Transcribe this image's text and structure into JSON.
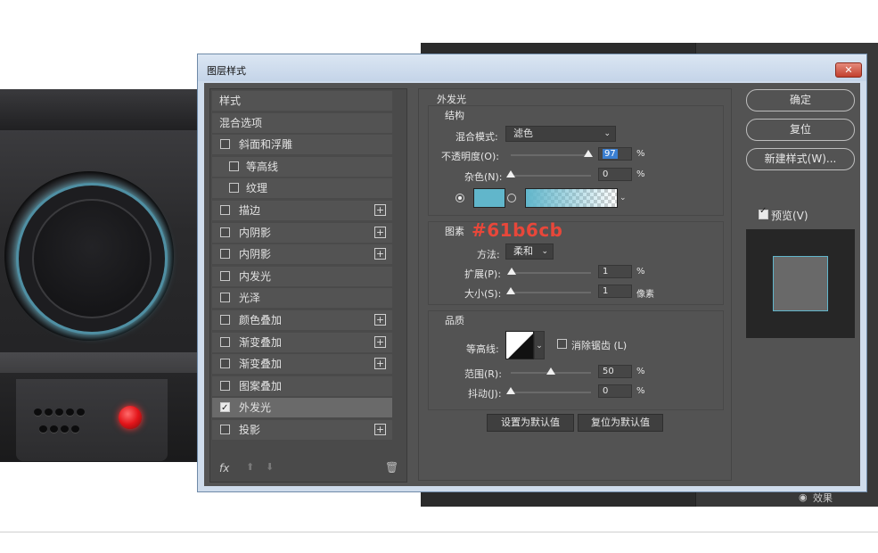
{
  "dialog": {
    "title": "图层样式",
    "close_label": "✕"
  },
  "styles": {
    "items": [
      {
        "label": "样式",
        "checkbox": false,
        "checked": false,
        "indent": false,
        "plus": false
      },
      {
        "label": "混合选项",
        "checkbox": false,
        "checked": false,
        "indent": false,
        "plus": false
      },
      {
        "label": "斜面和浮雕",
        "checkbox": true,
        "checked": false,
        "indent": false,
        "plus": false
      },
      {
        "label": "等高线",
        "checkbox": true,
        "checked": false,
        "indent": true,
        "plus": false
      },
      {
        "label": "纹理",
        "checkbox": true,
        "checked": false,
        "indent": true,
        "plus": false
      },
      {
        "label": "描边",
        "checkbox": true,
        "checked": false,
        "indent": false,
        "plus": true
      },
      {
        "label": "内阴影",
        "checkbox": true,
        "checked": false,
        "indent": false,
        "plus": true
      },
      {
        "label": "内阴影",
        "checkbox": true,
        "checked": false,
        "indent": false,
        "plus": true
      },
      {
        "label": "内发光",
        "checkbox": true,
        "checked": false,
        "indent": false,
        "plus": false
      },
      {
        "label": "光泽",
        "checkbox": true,
        "checked": false,
        "indent": false,
        "plus": false
      },
      {
        "label": "颜色叠加",
        "checkbox": true,
        "checked": false,
        "indent": false,
        "plus": true
      },
      {
        "label": "渐变叠加",
        "checkbox": true,
        "checked": false,
        "indent": false,
        "plus": true
      },
      {
        "label": "渐变叠加",
        "checkbox": true,
        "checked": false,
        "indent": false,
        "plus": true
      },
      {
        "label": "图案叠加",
        "checkbox": true,
        "checked": false,
        "indent": false,
        "plus": false
      },
      {
        "label": "外发光",
        "checkbox": true,
        "checked": true,
        "indent": false,
        "plus": false,
        "selected": true
      },
      {
        "label": "投影",
        "checkbox": true,
        "checked": false,
        "indent": false,
        "plus": true
      }
    ],
    "footer": {
      "fx": "fx",
      "up": "⬆",
      "down": "⬇",
      "trash": "🗑"
    }
  },
  "outer_glow": {
    "title": "外发光",
    "structure": {
      "title": "结构",
      "blend_mode_label": "混合模式:",
      "blend_mode_value": "滤色",
      "opacity_label": "不透明度(O):",
      "opacity_value": "97",
      "opacity_level": 0.97,
      "noise_label": "杂色(N):",
      "noise_value": "0",
      "noise_level": 0.0,
      "percent": "%",
      "color": "#61b6cb"
    },
    "annotation": "#61b6cb",
    "elements": {
      "title": "图素",
      "method_label": "方法:",
      "method_value": "柔和",
      "spread_label": "扩展(P):",
      "spread_value": "1",
      "spread_level": 0.01,
      "size_label": "大小(S):",
      "size_value": "1",
      "size_level": 0.004,
      "pixels_unit": "像素",
      "percent": "%"
    },
    "quality": {
      "title": "品质",
      "contour_label": "等高线:",
      "antialias_label": "消除锯齿 (L)",
      "range_label": "范围(R):",
      "range_value": "50",
      "range_level": 0.5,
      "jitter_label": "抖动(J):",
      "jitter_value": "0",
      "jitter_level": 0.0,
      "percent": "%"
    },
    "set_default": "设置为默认值",
    "reset_default": "复位为默认值"
  },
  "actions": {
    "ok": "确定",
    "reset": "复位",
    "new_style": "新建样式(W)...",
    "preview_label": "预览(V)"
  },
  "background_panel": {
    "effects_label": "效果"
  }
}
